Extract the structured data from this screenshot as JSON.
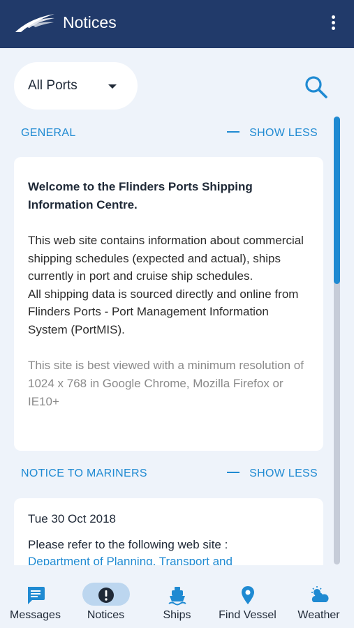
{
  "app": {
    "title": "Notices"
  },
  "filter": {
    "selected_port": "All Ports"
  },
  "sections": [
    {
      "title": "GENERAL",
      "toggle_label": "SHOW LESS",
      "card": {
        "lead": "Welcome to the Flinders Ports Shipping Information Centre.",
        "body_1": "This web site contains information about commercial shipping schedules (expected and actual), ships currently in port and cruise ship schedules.",
        "body_2": "All shipping data is sourced directly and online from Flinders Ports - Port Management Information System (PortMIS).",
        "muted": "This site is best viewed with a minimum resolution of 1024 x 768 in Google Chrome, Mozilla Firefox or IE10+"
      }
    },
    {
      "title": "NOTICE TO MARINERS",
      "toggle_label": "SHOW LESS",
      "card": {
        "date": "Tue 30 Oct 2018",
        "refer": "Please refer to the following web site :",
        "link": "Department of Planning, Transport and"
      }
    }
  ],
  "scrollbar": {
    "position_fraction": 0
  },
  "nav": [
    {
      "label": "Messages",
      "icon": "message-icon"
    },
    {
      "label": "Notices",
      "icon": "alert-icon",
      "active": true
    },
    {
      "label": "Ships",
      "icon": "ship-icon"
    },
    {
      "label": "Find Vessel",
      "icon": "location-pin-icon"
    },
    {
      "label": "Weather",
      "icon": "weather-icon"
    }
  ],
  "colors": {
    "header": "#213a6a",
    "accent": "#1f8ad2",
    "background": "#eef3fa",
    "active_pill": "#bcd6ef"
  }
}
